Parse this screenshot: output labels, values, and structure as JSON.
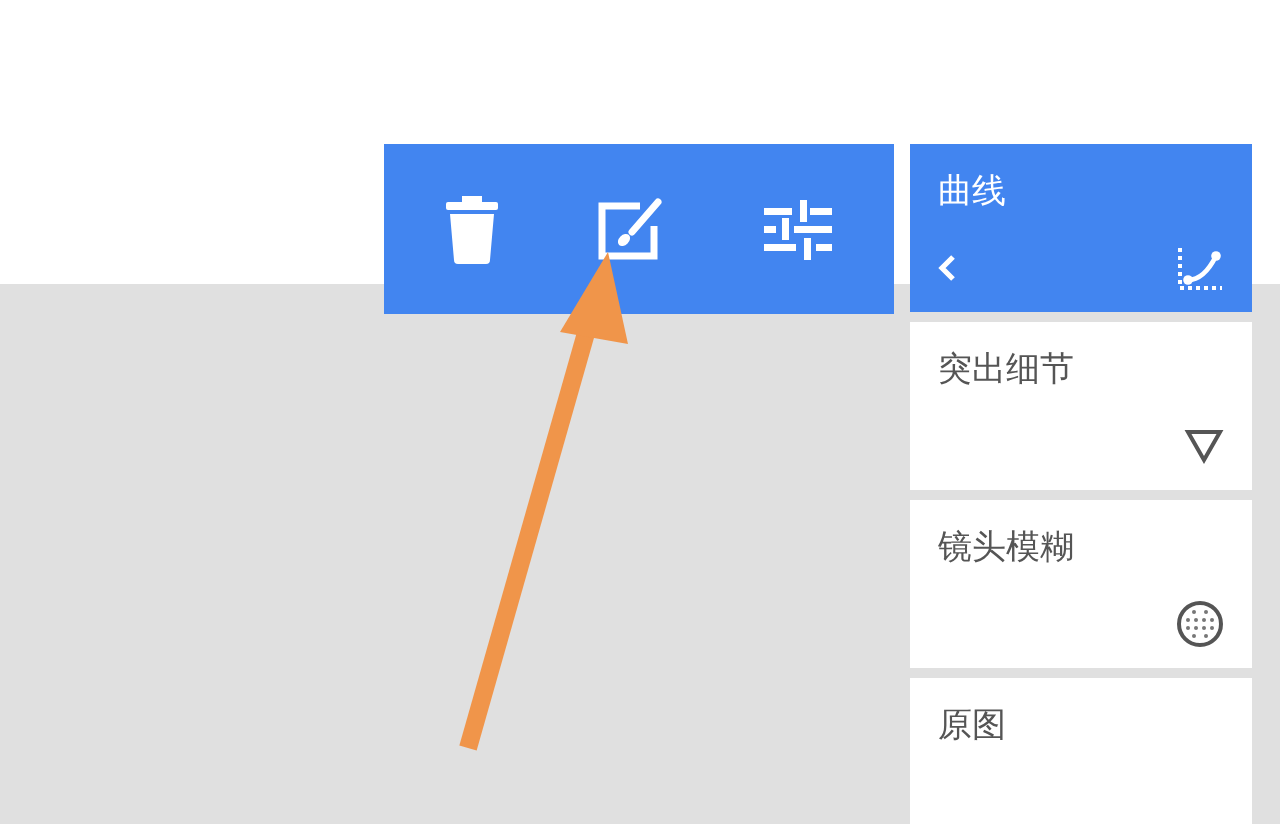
{
  "toolbar": {
    "tools": [
      {
        "kind": "trash"
      },
      {
        "kind": "edit"
      },
      {
        "kind": "sliders"
      }
    ]
  },
  "filters": [
    {
      "label": "曲线",
      "kind": "curve",
      "selected": true
    },
    {
      "label": "突出细节",
      "kind": "triangle",
      "selected": false
    },
    {
      "label": "镜头模糊",
      "kind": "dots",
      "selected": false
    },
    {
      "label": "原图",
      "kind": "none",
      "selected": false
    }
  ]
}
